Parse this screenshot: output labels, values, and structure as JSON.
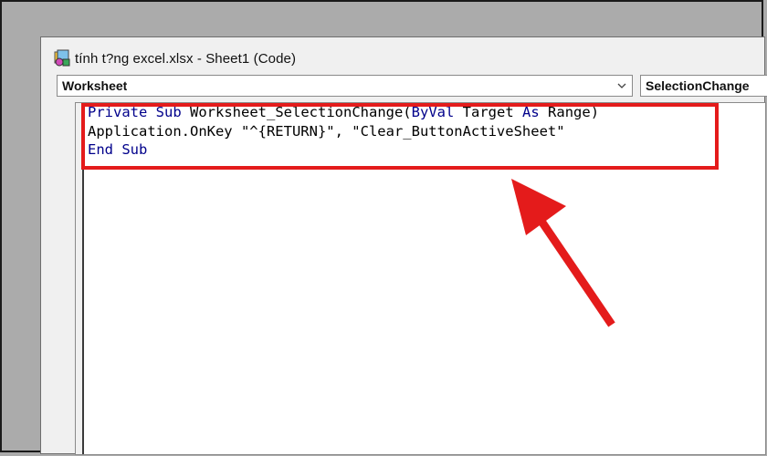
{
  "window": {
    "title": "tính t?ng excel.xlsx - Sheet1 (Code)"
  },
  "object_combo": {
    "value": "Worksheet"
  },
  "procedure_combo": {
    "value": "SelectionChange"
  },
  "code": {
    "line1": {
      "kw_private": "Private",
      "kw_sub": "Sub",
      "proc_name": "Worksheet_SelectionChange(",
      "kw_byval": "ByVal",
      "param": "Target",
      "kw_as": "As",
      "type": "Range)"
    },
    "line2": {
      "text": "Application.OnKey \"^{RETURN}\", \"Clear_ButtonActiveSheet\""
    },
    "line3": {
      "kw_end": "End",
      "kw_sub": "Sub"
    }
  },
  "colors": {
    "keyword": "#00008b",
    "annotation": "#e41b1b",
    "background": "#ababab"
  },
  "icons": {
    "app": "vba-module-icon",
    "dropdown": "chevron-down-icon",
    "annotation": "red-arrow"
  }
}
